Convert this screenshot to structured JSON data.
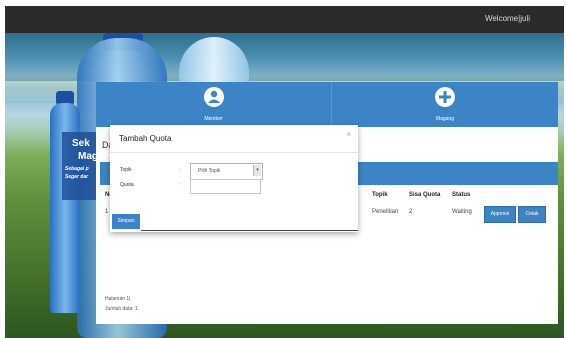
{
  "header": {
    "welcome_text": "Welcome|juli"
  },
  "banner": {
    "line1": "Sek",
    "line2": "Mag",
    "tagline1": "Sebagai p",
    "tagline2": "Segar dar"
  },
  "tiles": [
    {
      "label": "Member",
      "icon": "user-icon"
    },
    {
      "label": "Magang",
      "icon": "plus-icon"
    }
  ],
  "behind": {
    "title_fragment": "Da",
    "columns": {
      "no": "No",
      "topik": "Topik",
      "sisa_quota": "Sisa Quota",
      "status": "Status"
    },
    "row": {
      "no": "1",
      "topik": "Penelitian",
      "sisa_quota": "2",
      "status": "Waiting"
    },
    "buttons": {
      "approve": "Approve",
      "cetak": "Cetak"
    },
    "pager": {
      "halaman": "Halaman 1|",
      "jumlah": "Jumlah data: 1"
    }
  },
  "modal": {
    "title": "Tambah Quota",
    "close": "×",
    "fields": [
      {
        "label": "Topik",
        "colon": ":"
      },
      {
        "label": "Quota",
        "colon": ":"
      }
    ],
    "select_value": "Pilih Topik",
    "quota_value": "",
    "submit_label": "Simpan"
  },
  "colors": {
    "primary": "#3d84c6",
    "topbar": "#2b2b2b"
  }
}
